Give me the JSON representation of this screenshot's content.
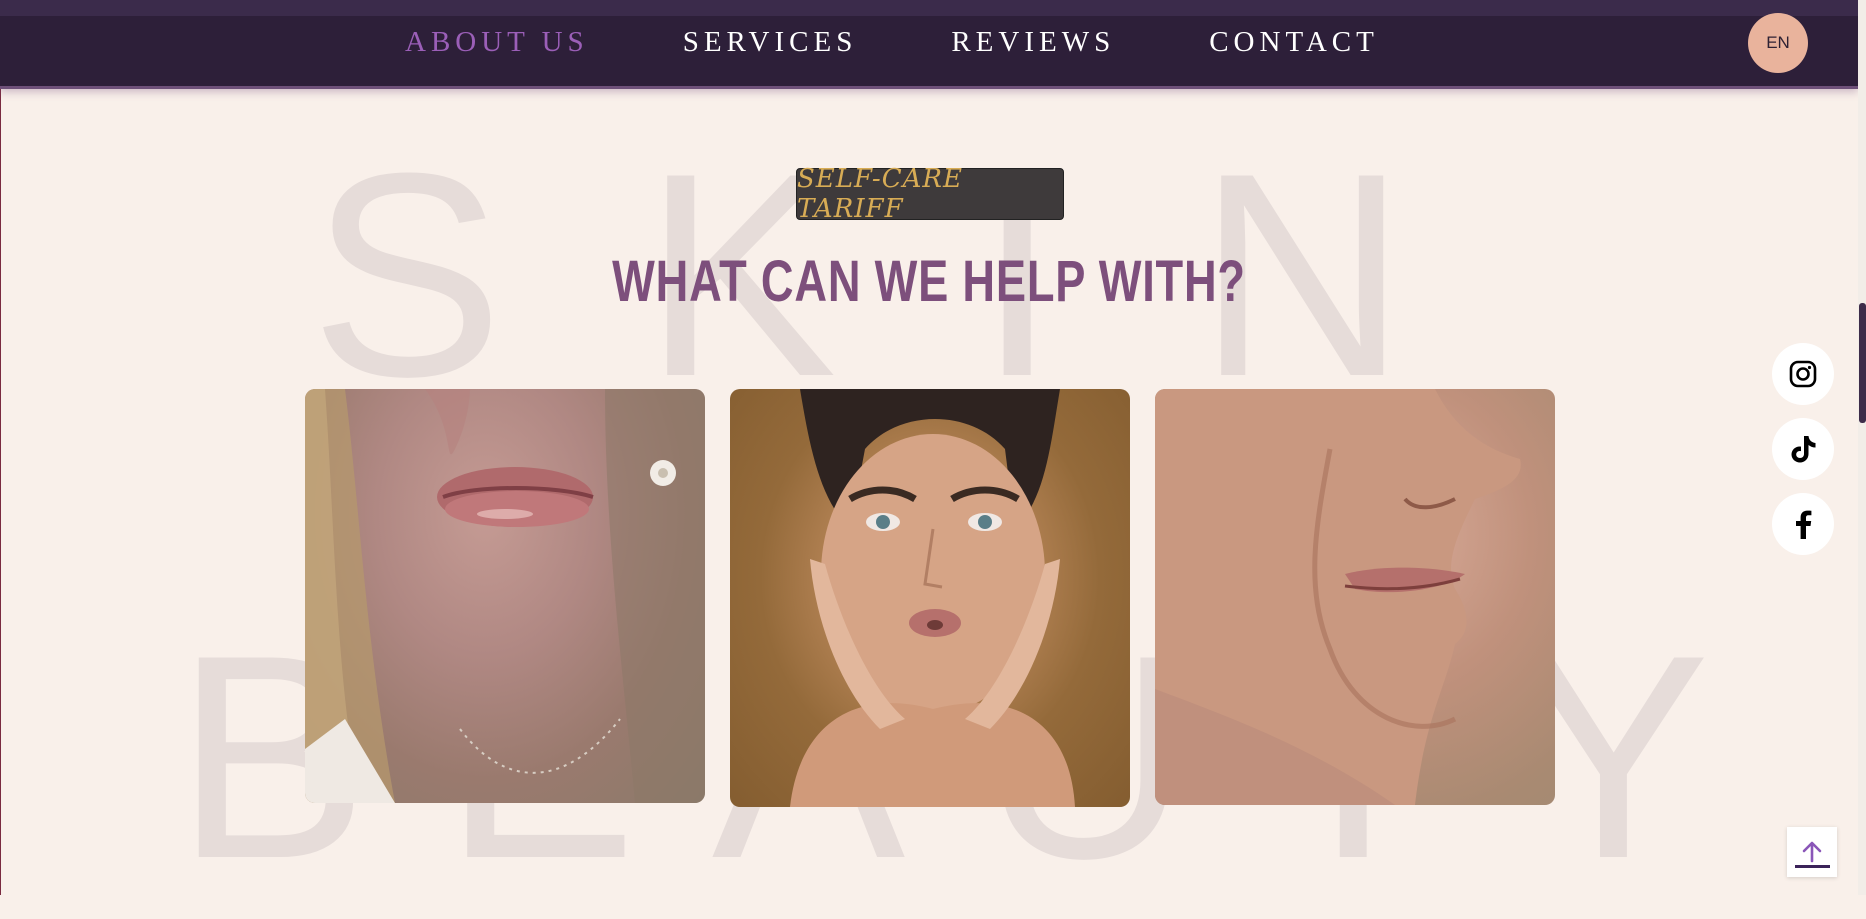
{
  "nav": {
    "links": [
      {
        "label": "ABOUT US",
        "active": true
      },
      {
        "label": "SERVICES",
        "active": false
      },
      {
        "label": "REVIEWS",
        "active": false
      },
      {
        "label": "CONTACT",
        "active": false
      }
    ],
    "language": "EN"
  },
  "background": {
    "word_top": "SKIN",
    "word_bottom": "BEAUTY"
  },
  "section": {
    "tag": "SELF-CARE TARIFF",
    "heading": "WHAT CAN WE HELP WITH?"
  },
  "cards": [
    {
      "icon": "lips-closeup-photo"
    },
    {
      "icon": "face-portrait-photo"
    },
    {
      "icon": "profile-nose-photo"
    }
  ],
  "social": [
    {
      "icon": "instagram-icon"
    },
    {
      "icon": "tiktok-icon"
    },
    {
      "icon": "facebook-icon"
    }
  ],
  "colors": {
    "nav_bg": "#2d1f39",
    "accent_active": "#9b5fb8",
    "heading": "#7d4f7c",
    "tag_text": "#d8ac55",
    "page_bg": "#f9f0ea",
    "lang_badge": "#e9b39c"
  }
}
